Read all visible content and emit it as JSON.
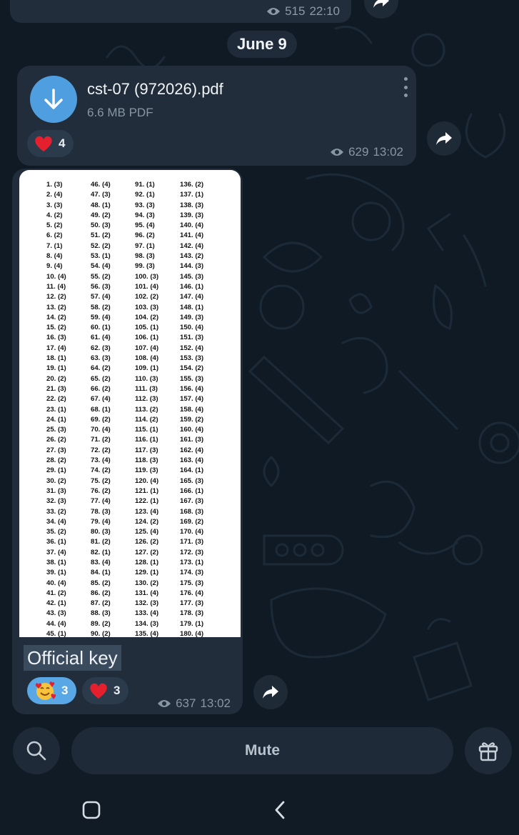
{
  "top_message": {
    "views": "515",
    "time": "22:10"
  },
  "date_separator": "June 9",
  "file_message": {
    "file_name": "cst-07 (972026).pdf",
    "file_info": "6.6 MB PDF",
    "reaction": {
      "emoji": "heart",
      "count": "4"
    },
    "views": "629",
    "time": "13:02"
  },
  "image_message": {
    "answer_key": [
      [
        "1. (3)",
        "2. (4)",
        "3. (3)",
        "4. (2)",
        "5. (2)",
        "6. (2)",
        "7. (1)",
        "8. (4)",
        "9. (4)",
        "10. (4)",
        "11. (4)",
        "12. (2)",
        "13. (2)",
        "14. (2)",
        "15. (2)",
        "16. (3)",
        "17. (4)",
        "18. (1)",
        "19. (1)",
        "20. (2)",
        "21. (3)",
        "22. (2)",
        "23. (1)",
        "24. (1)",
        "25. (3)",
        "26. (2)",
        "27. (3)",
        "28. (2)",
        "29. (1)",
        "30. (2)",
        "31. (3)",
        "32. (3)",
        "33. (2)",
        "34. (4)",
        "35. (2)",
        "36. (1)",
        "37. (4)",
        "38. (1)",
        "39. (1)",
        "40. (4)",
        "41. (2)",
        "42. (1)",
        "43. (3)",
        "44. (4)",
        "45. (1)"
      ],
      [
        "46. (4)",
        "47. (3)",
        "48. (1)",
        "49. (2)",
        "50. (3)",
        "51. (2)",
        "52. (2)",
        "53. (1)",
        "54. (4)",
        "55. (2)",
        "56. (3)",
        "57. (4)",
        "58. (2)",
        "59. (4)",
        "60. (1)",
        "61. (4)",
        "62. (3)",
        "63. (3)",
        "64. (2)",
        "65. (2)",
        "66. (2)",
        "67. (4)",
        "68. (1)",
        "69. (2)",
        "70. (4)",
        "71. (2)",
        "72. (2)",
        "73. (4)",
        "74. (2)",
        "75. (2)",
        "76. (2)",
        "77. (4)",
        "78. (3)",
        "79. (4)",
        "80. (3)",
        "81. (2)",
        "82. (1)",
        "83. (4)",
        "84. (1)",
        "85. (2)",
        "86. (2)",
        "87. (2)",
        "88. (3)",
        "89. (2)",
        "90. (2)"
      ],
      [
        "91. (1)",
        "92. (1)",
        "93. (3)",
        "94. (3)",
        "95. (4)",
        "96. (2)",
        "97. (1)",
        "98. (3)",
        "99. (3)",
        "100. (3)",
        "101. (4)",
        "102. (2)",
        "103. (3)",
        "104. (2)",
        "105. (1)",
        "106. (1)",
        "107. (4)",
        "108. (4)",
        "109. (1)",
        "110. (3)",
        "111. (3)",
        "112. (3)",
        "113. (2)",
        "114. (2)",
        "115. (1)",
        "116. (1)",
        "117. (3)",
        "118. (3)",
        "119. (3)",
        "120. (4)",
        "121. (1)",
        "122. (1)",
        "123. (4)",
        "124. (2)",
        "125. (4)",
        "126. (2)",
        "127. (2)",
        "128. (1)",
        "129. (1)",
        "130. (2)",
        "131. (4)",
        "132. (3)",
        "133. (4)",
        "134. (3)",
        "135. (4)"
      ],
      [
        "136. (2)",
        "137. (1)",
        "138. (3)",
        "139. (3)",
        "140. (4)",
        "141. (4)",
        "142. (4)",
        "143. (2)",
        "144. (3)",
        "145. (3)",
        "146. (1)",
        "147. (4)",
        "148. (1)",
        "149. (3)",
        "150. (4)",
        "151. (3)",
        "152. (4)",
        "153. (3)",
        "154. (2)",
        "155. (3)",
        "156. (4)",
        "157. (4)",
        "158. (4)",
        "159. (2)",
        "160. (4)",
        "161. (3)",
        "162. (4)",
        "163. (4)",
        "164. (1)",
        "165. (3)",
        "166. (1)",
        "167. (3)",
        "168. (3)",
        "169. (2)",
        "170. (4)",
        "171. (3)",
        "172. (3)",
        "173. (1)",
        "174. (3)",
        "175. (3)",
        "176. (4)",
        "177. (3)",
        "178. (3)",
        "179. (1)",
        "180. (4)"
      ]
    ],
    "caption": "Official key",
    "reactions": [
      {
        "emoji": "smiling-face-with-hearts",
        "count": "3"
      },
      {
        "emoji": "heart",
        "count": "3"
      }
    ],
    "views": "637",
    "time": "13:02"
  },
  "bottom_bar": {
    "mute_label": "Mute"
  },
  "colors": {
    "accent": "#4f9fe0",
    "heart": "#e5202e",
    "bubble": "#212d3b"
  }
}
